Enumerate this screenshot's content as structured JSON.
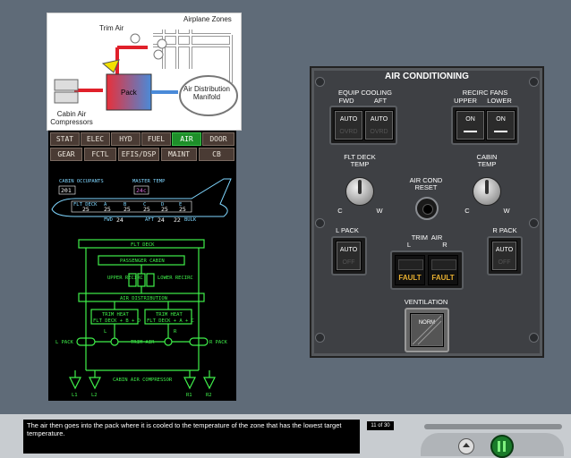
{
  "schematic": {
    "trim_air": "Trim Air",
    "airplane_zones": "Airplane Zones",
    "pack": "Pack",
    "air_distribution_manifold": "Air Distribution Manifold",
    "cabin_air_compressors": "Cabin Air Compressors"
  },
  "tabs": {
    "row1": [
      "STAT",
      "ELEC",
      "HYD",
      "FUEL",
      "AIR",
      "DOOR"
    ],
    "row2": [
      "GEAR",
      "FCTL",
      "EFIS/DSP",
      "MAINT",
      "CB"
    ],
    "active": "AIR"
  },
  "synoptic": {
    "cabin_occupants_label": "CABIN OCCUPANTS",
    "cabin_occupants": "201",
    "master_temp_label": "MASTER TEMP",
    "master_temp": "24c",
    "flt_deck_small": "FLT DECK",
    "zone_letters": [
      "A",
      "B",
      "C",
      "D",
      "E"
    ],
    "zone_values": [
      "25",
      "25",
      "25",
      "25",
      "25",
      "25"
    ],
    "fwd_label": "FWD",
    "fwd_value": "24",
    "aft_label": "AFT",
    "aft_value": "24",
    "bulk_value": "22",
    "bulk_label": "BULK",
    "flt_deck": "FLT DECK",
    "passenger_cabin": "PASSENGER CABIN",
    "upper_recirc": "UPPER RECIRC",
    "lower_recirc": "LOWER RECIRC",
    "air_distribution": "AIR DISTRIBUTION",
    "trim_heat_left_1": "TRIM HEAT",
    "trim_heat_left_2": "FLT DECK + B + D",
    "trim_heat_right_1": "TRIM HEAT",
    "trim_heat_right_2": "FLT DECK + A + C",
    "l_pack": "L PACK",
    "r_pack": "R PACK",
    "trim_air": "TRIM AIR",
    "cabin_air_compressor": "CABIN AIR COMPRESSOR",
    "l1": "L1",
    "l2": "L2",
    "r1": "R1",
    "r2": "R2",
    "l_marker": "L",
    "r_marker": "R"
  },
  "panel": {
    "title": "AIR CONDITIONING",
    "equip_cooling": "EQUIP COOLING",
    "fwd": "FWD",
    "aft": "AFT",
    "auto": "AUTO",
    "ovrd": "OVRD",
    "recirc_fans": "RECIRC FANS",
    "upper": "UPPER",
    "lower": "LOWER",
    "on": "ON",
    "flt_deck_temp_1": "FLT DECK",
    "flt_deck_temp_2": "TEMP",
    "cabin_temp_1": "CABIN",
    "cabin_temp_2": "TEMP",
    "c": "C",
    "w": "W",
    "air_cond_reset_1": "AIR COND",
    "air_cond_reset_2": "RESET",
    "l_pack": "L PACK",
    "r_pack": "R PACK",
    "off": "OFF",
    "trim_air": "TRIM  AIR",
    "l": "L",
    "r": "R",
    "fault": "FAULT",
    "ventilation": "VENTILATION",
    "norm": "NORM"
  },
  "bottom": {
    "caption": "The air then goes into the pack where it is cooled to the temperature of the zone that has the lowest target temperature.",
    "page": "11 of 30"
  }
}
